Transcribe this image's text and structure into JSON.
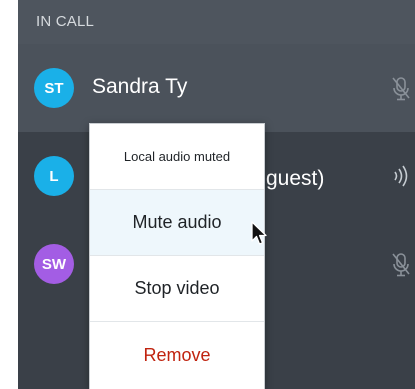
{
  "panel": {
    "header_label": "IN CALL"
  },
  "participants": [
    {
      "initials": "ST",
      "name": "Sandra Ty",
      "avatar_color": "#1ab0e8",
      "status_icon": "mic-muted-icon"
    },
    {
      "initials": "L",
      "name": "guest)",
      "avatar_color": "#1ab0e8",
      "status_icon": "speaking-icon"
    },
    {
      "initials": "SW",
      "name": "",
      "avatar_color": "#a35de4",
      "status_icon": "mic-muted-icon"
    }
  ],
  "context_menu": {
    "status_text": "Local audio muted",
    "items": [
      {
        "label": "Mute audio"
      },
      {
        "label": "Stop video"
      },
      {
        "label": "Remove"
      }
    ]
  },
  "colors": {
    "panel_bg": "#3a4048",
    "header_bg": "#4e555e",
    "selected_row_bg": "#4b525b",
    "remove_text": "#c0230f",
    "hover_item_bg": "#eef7fc"
  }
}
